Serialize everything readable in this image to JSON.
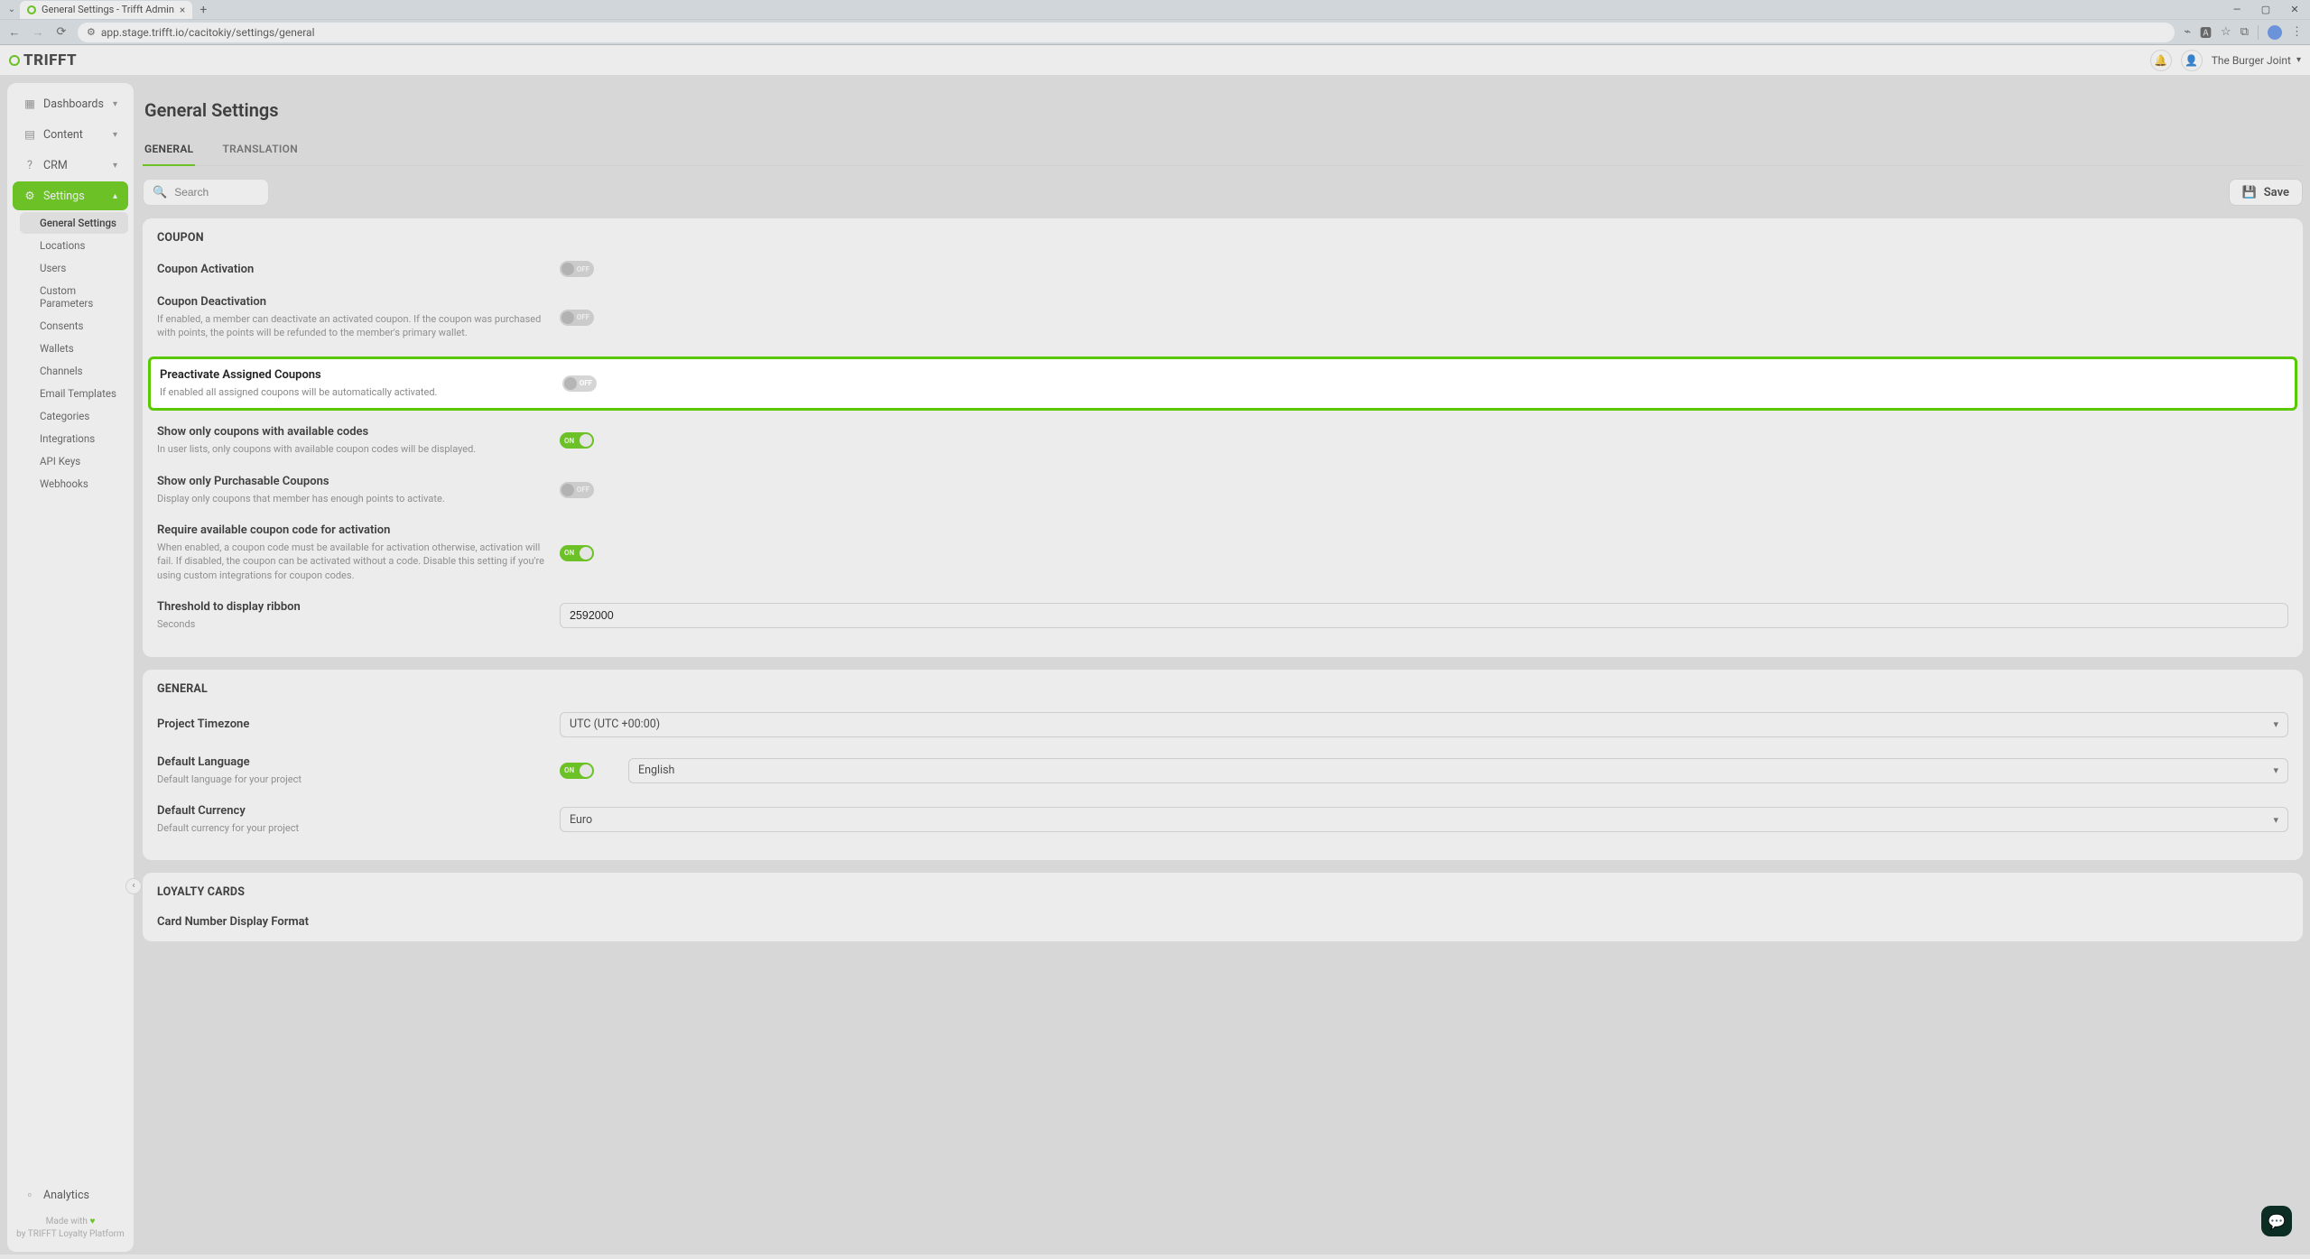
{
  "browser": {
    "tab_title": "General Settings - Trifft Admin",
    "url": "app.stage.trifft.io/cacitokiy/settings/general"
  },
  "header": {
    "brand": "TRIFFT",
    "workspace": "The Burger Joint"
  },
  "sidebar": {
    "items": [
      {
        "label": "Dashboards",
        "icon": "dashboard",
        "expanded": false
      },
      {
        "label": "Content",
        "icon": "content",
        "expanded": false
      },
      {
        "label": "CRM",
        "icon": "question",
        "expanded": false
      },
      {
        "label": "Settings",
        "icon": "gear",
        "expanded": true,
        "active": true
      }
    ],
    "settings_children": [
      {
        "label": "General Settings",
        "active": true
      },
      {
        "label": "Locations"
      },
      {
        "label": "Users"
      },
      {
        "label": "Custom Parameters"
      },
      {
        "label": "Consents"
      },
      {
        "label": "Wallets"
      },
      {
        "label": "Channels"
      },
      {
        "label": "Email Templates"
      },
      {
        "label": "Categories"
      },
      {
        "label": "Integrations"
      },
      {
        "label": "API Keys"
      },
      {
        "label": "Webhooks"
      }
    ],
    "analytics_label": "Analytics",
    "credit_line1": "Made with",
    "credit_line2": "by TRIFFT Loyalty Platform"
  },
  "page": {
    "title": "General Settings",
    "tabs": {
      "general": "GENERAL",
      "translation": "TRANSLATION"
    },
    "search_placeholder": "Search",
    "save_label": "Save"
  },
  "coupon_section": {
    "heading": "COUPON",
    "rows": {
      "activation": {
        "title": "Coupon Activation",
        "state": "OFF"
      },
      "deactivation": {
        "title": "Coupon Deactivation",
        "desc": "If enabled, a member can deactivate an activated coupon. If the coupon was purchased with points, the points will be refunded to the member's primary wallet.",
        "state": "OFF"
      },
      "preactivate": {
        "title": "Preactivate Assigned Coupons",
        "desc": "If enabled all assigned coupons will be automatically activated.",
        "state": "OFF"
      },
      "show_available": {
        "title": "Show only coupons with available codes",
        "desc": "In user lists, only coupons with available coupon codes will be displayed.",
        "state": "ON"
      },
      "show_purchasable": {
        "title": "Show only Purchasable Coupons",
        "desc": "Display only coupons that member has enough points to activate.",
        "state": "OFF"
      },
      "require_code": {
        "title": "Require available coupon code for activation",
        "desc": "When enabled, a coupon code must be available for activation otherwise, activation will fail. If disabled, the coupon can be activated without a code. Disable this setting if you're using custom integrations for coupon codes.",
        "state": "ON"
      },
      "threshold": {
        "title": "Threshold to display ribbon",
        "desc": "Seconds",
        "value": "2592000"
      }
    }
  },
  "general_section": {
    "heading": "GENERAL",
    "rows": {
      "timezone": {
        "title": "Project Timezone",
        "value": "UTC (UTC +00:00)"
      },
      "language": {
        "title": "Default Language",
        "desc": "Default language for your project",
        "state": "ON",
        "value": "English"
      },
      "currency": {
        "title": "Default Currency",
        "desc": "Default currency for your project",
        "value": "Euro"
      }
    }
  },
  "loyalty_section": {
    "heading": "LOYALTY CARDS",
    "rows": {
      "card_format": {
        "title": "Card Number Display Format"
      }
    }
  },
  "toggle_labels": {
    "on": "ON",
    "off": "OFF"
  }
}
